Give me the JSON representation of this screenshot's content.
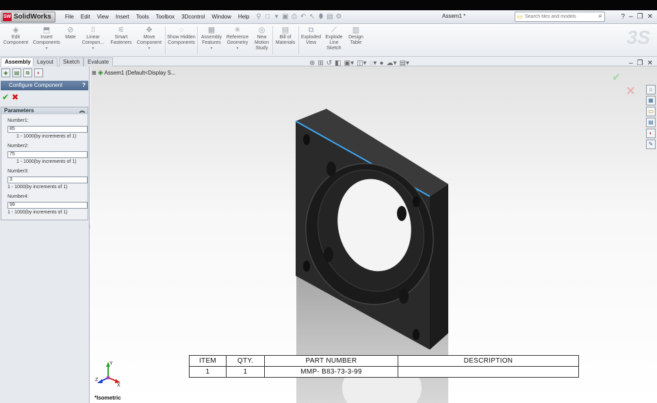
{
  "app": {
    "name": "SolidWorks",
    "doc_title": "Assem1 *"
  },
  "menu": [
    "File",
    "Edit",
    "View",
    "Insert",
    "Tools",
    "Toolbox",
    "3Dcontrol",
    "Window",
    "Help"
  ],
  "search": {
    "placeholder": "Search files and models"
  },
  "toolbar": [
    {
      "label": "Edit Component",
      "icon": "edit-component-icon",
      "dropdown": false
    },
    {
      "label": "Insert Components",
      "icon": "insert-components-icon",
      "dropdown": true
    },
    {
      "label": "Mate",
      "icon": "mate-icon",
      "dropdown": false
    },
    {
      "label": "Linear Compon...",
      "icon": "linear-pattern-icon",
      "dropdown": true
    },
    {
      "label": "Smart Fasteners",
      "icon": "smart-fasteners-icon",
      "dropdown": false
    },
    {
      "label": "Move Component",
      "icon": "move-component-icon",
      "dropdown": true
    },
    {
      "label": "Show Hidden Components",
      "icon": "show-hidden-icon",
      "dropdown": false
    },
    {
      "label": "Assembly Features",
      "icon": "assembly-features-icon",
      "dropdown": true
    },
    {
      "label": "Reference Geometry",
      "icon": "reference-geometry-icon",
      "dropdown": true
    },
    {
      "label": "New Motion Study",
      "icon": "motion-study-icon",
      "dropdown": false
    },
    {
      "label": "Bill of Materials",
      "icon": "bom-icon",
      "dropdown": false
    },
    {
      "label": "Exploded View",
      "icon": "exploded-view-icon",
      "dropdown": false
    },
    {
      "label": "Explode Line Sketch",
      "icon": "explode-line-icon",
      "dropdown": false
    },
    {
      "label": "Design Table",
      "icon": "design-table-icon",
      "dropdown": false
    }
  ],
  "tabs": [
    "Assembly",
    "Layout",
    "Sketch",
    "Evaluate"
  ],
  "panel": {
    "title": "Configure Component",
    "help": "?",
    "section": "Parameters",
    "params": [
      {
        "label": "Number1:",
        "value": "85",
        "hint": "1 - 1000(by increments of 1)"
      },
      {
        "label": "Number2:",
        "value": "75",
        "hint": "1 - 1000(by increments of 1)"
      },
      {
        "label": "Number3:",
        "value": "3",
        "hint": "1 - 1000(by increments of 1)"
      },
      {
        "label": "Number4:",
        "value": "99",
        "hint": "1 - 1000(by increments of 1)"
      }
    ]
  },
  "tree": {
    "root": "Assem1  (Default<Display S..."
  },
  "bom": {
    "headers": [
      "ITEM",
      "QTY.",
      "PART NUMBER",
      "DESCRIPTION"
    ],
    "rows": [
      [
        "1",
        "1",
        "MMP- B83-73-3-99",
        ""
      ]
    ]
  },
  "view": {
    "name": "*Isometric"
  },
  "triad": {
    "x": "X",
    "y": "Y",
    "z": "Z"
  },
  "colors": {
    "brand": "#c8102e",
    "accept": "#19a219",
    "cancel": "#d01818",
    "panel_header": "#5a7499",
    "edge_highlight": "#3fa9f5"
  }
}
